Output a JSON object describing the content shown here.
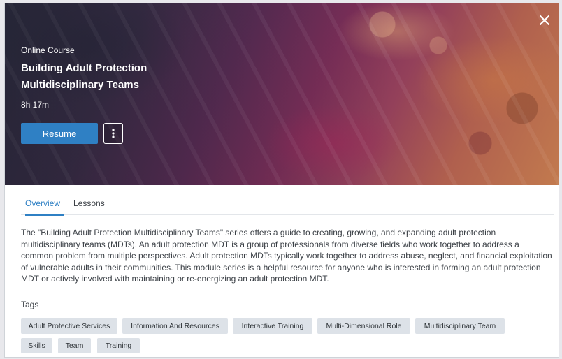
{
  "hero": {
    "course_type": "Online Course",
    "title": "Building Adult Protection Multidisciplinary Teams",
    "duration": "8h 17m",
    "resume_label": "Resume",
    "more_icon": "vertical-ellipsis-icon",
    "close_icon": "close-icon"
  },
  "tabs": [
    {
      "label": "Overview",
      "active": true
    },
    {
      "label": "Lessons",
      "active": false
    }
  ],
  "overview": {
    "description": "The \"Building Adult Protection Multidisciplinary Teams\" series offers a guide to creating, growing, and expanding adult protection multidisciplinary teams (MDTs). An adult protection MDT is a group of professionals from diverse fields who work together to address a common problem from multiple perspectives. Adult protection MDTs typically work together to address abuse, neglect, and financial exploitation of vulnerable adults in their communities. This module series is a helpful resource for anyone who is interested in forming an adult protection MDT or actively involved with maintaining or re-energizing an adult protection MDT."
  },
  "tags": {
    "heading": "Tags",
    "items": [
      "Adult Protective Services",
      "Information And Resources",
      "Interactive Training",
      "Multi-Dimensional Role",
      "Multidisciplinary Team",
      "Skills",
      "Team",
      "Training"
    ]
  },
  "colors": {
    "accent": "#2f80c4",
    "tag_bg": "#dde2e8",
    "text": "#3a3f45"
  }
}
